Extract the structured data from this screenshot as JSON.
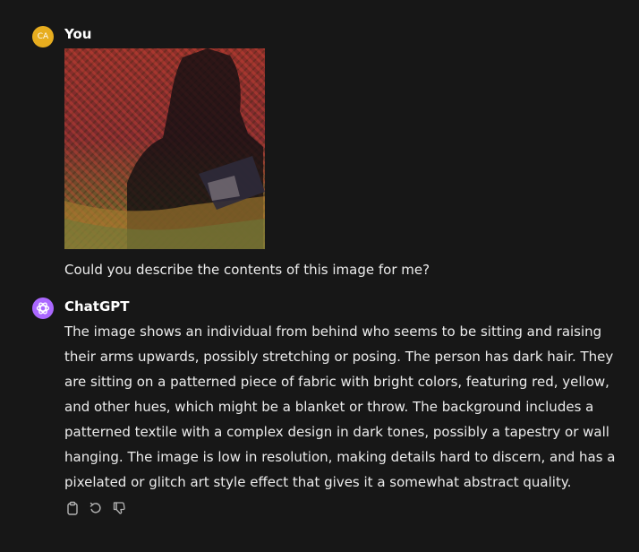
{
  "user_message": {
    "avatar_initials": "CA",
    "author": "You",
    "text": "Could you describe the contents of this image for me?",
    "avatar_color": "#e7ad1f"
  },
  "assistant_message": {
    "author": "ChatGPT",
    "avatar_color": "#ab68ff",
    "text": "The image shows an individual from behind who seems to be sitting and raising their arms upwards, possibly stretching or posing. The person has dark hair. They are sitting on a patterned piece of fabric with bright colors, featuring red, yellow, and other hues, which might be a blanket or throw. The background includes a patterned textile with a complex design in dark tones, possibly a tapestry or wall hanging. The image is low in resolution, making details hard to discern, and has a pixelated or glitch art style effect that gives it a somewhat abstract quality.",
    "actions": [
      "copy-icon",
      "regenerate-icon",
      "thumbs-down-icon"
    ]
  },
  "colors": {
    "background": "#171717",
    "text": "#ececec",
    "icon": "#b4b4b4"
  }
}
